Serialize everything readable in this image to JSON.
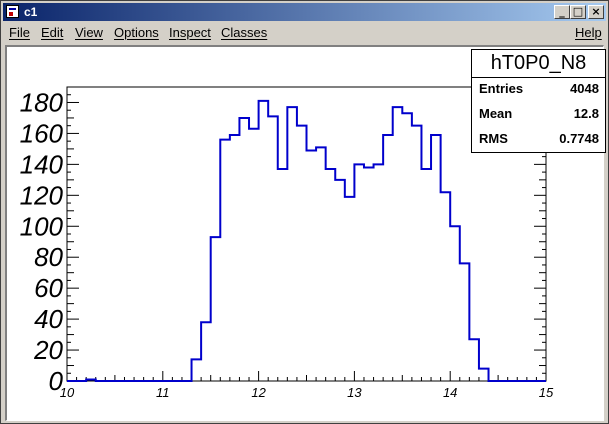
{
  "window": {
    "title": "c1",
    "buttons": {
      "minimize": "_",
      "maximize": "□",
      "close": "×"
    }
  },
  "menu": {
    "items": [
      "File",
      "Edit",
      "View",
      "Options",
      "Inspect",
      "Classes"
    ],
    "help": "Help"
  },
  "stats": {
    "title": "hT0P0_N8",
    "rows": [
      {
        "label": "Entries",
        "value": "4048"
      },
      {
        "label": "Mean",
        "value": "12.8"
      },
      {
        "label": "RMS",
        "value": "0.7748"
      }
    ]
  },
  "colors": {
    "line": "#0000cc",
    "titlebar": "#0a246a"
  },
  "chart_data": {
    "type": "histogram",
    "xlim": [
      10,
      15
    ],
    "ylim": [
      0,
      190
    ],
    "x_ticks": [
      "10",
      "11",
      "12",
      "13",
      "14",
      "15"
    ],
    "y_ticks": [
      "0",
      "20",
      "40",
      "60",
      "80",
      "100",
      "120",
      "140",
      "160",
      "180"
    ],
    "bin_edges": [
      10.0,
      10.1,
      10.2,
      10.3,
      10.4,
      10.5,
      10.6,
      10.7,
      10.8,
      10.9,
      11.0,
      11.1,
      11.2,
      11.3,
      11.4,
      11.5,
      11.6,
      11.7,
      11.8,
      11.9,
      12.0,
      12.1,
      12.2,
      12.3,
      12.4,
      12.5,
      12.6,
      12.7,
      12.8,
      12.9,
      13.0,
      13.1,
      13.2,
      13.3,
      13.4,
      13.5,
      13.6,
      13.7,
      13.8,
      13.9,
      14.0,
      14.1,
      14.2,
      14.3,
      14.4,
      14.5,
      14.6,
      14.7,
      14.8,
      14.9,
      15.0
    ],
    "values": [
      0,
      0,
      1,
      0,
      0,
      0,
      0,
      0,
      0,
      0,
      0,
      0,
      0,
      14,
      38,
      93,
      156,
      159,
      170,
      163,
      181,
      171,
      137,
      177,
      165,
      149,
      151,
      137,
      130,
      119,
      140,
      138,
      140,
      159,
      177,
      173,
      165,
      137,
      159,
      122,
      100,
      76,
      27,
      8,
      0,
      0,
      0,
      0,
      0,
      0
    ]
  }
}
